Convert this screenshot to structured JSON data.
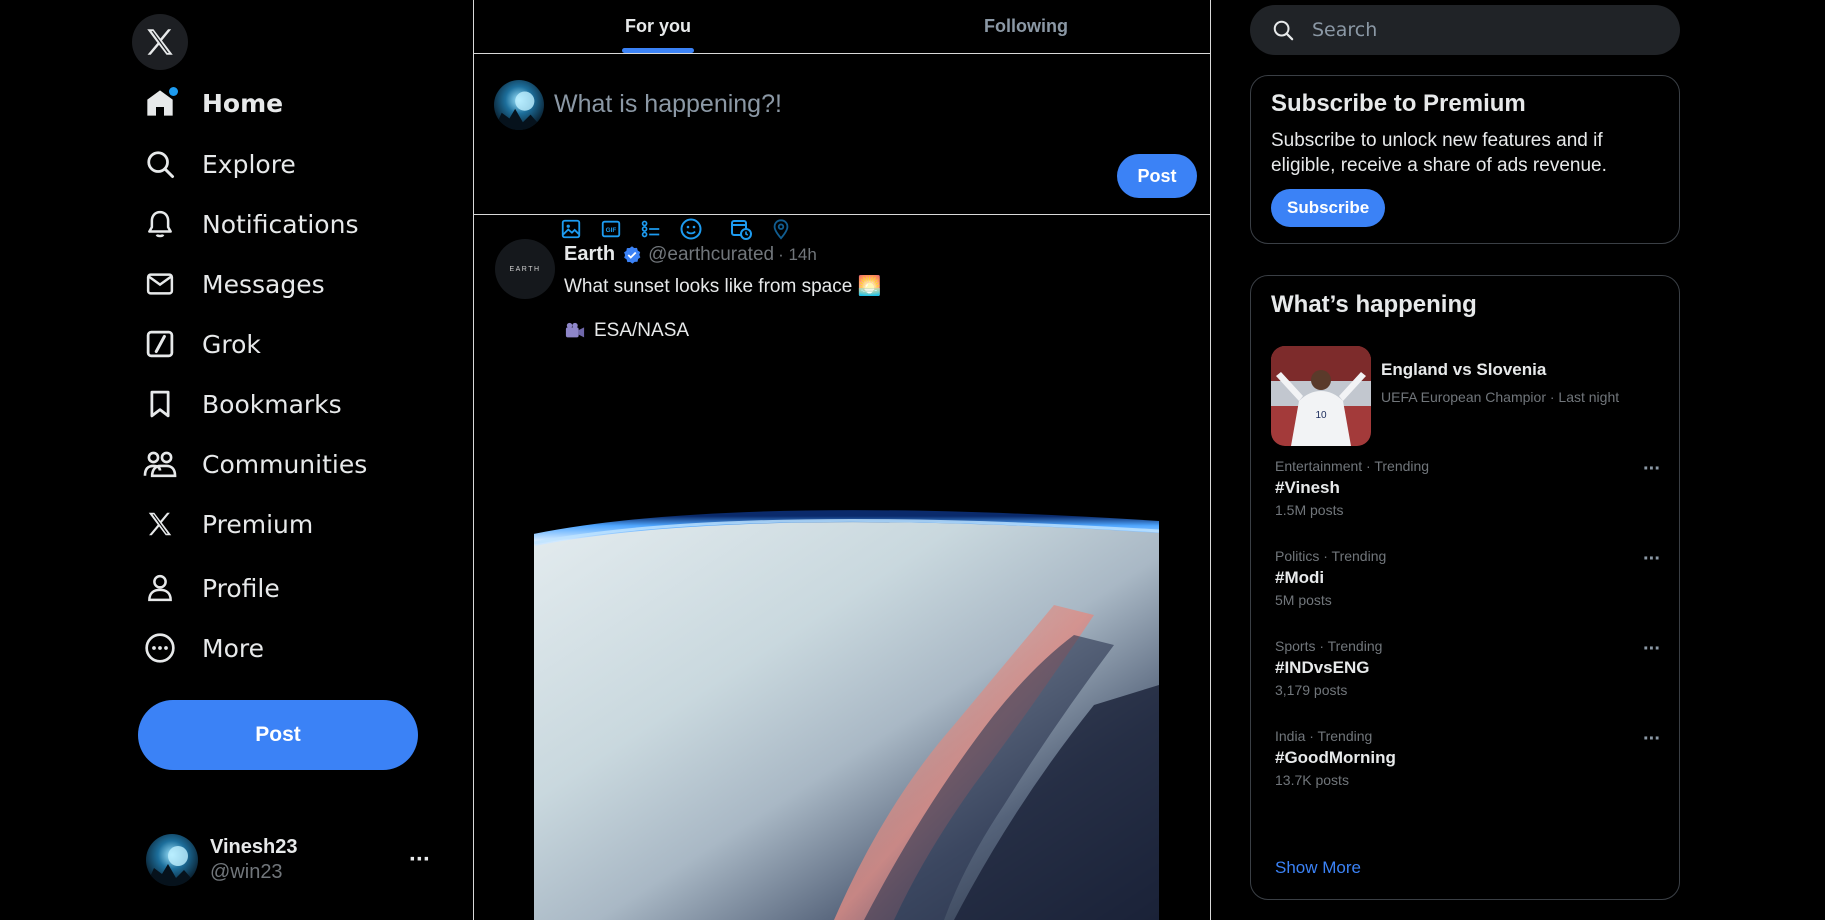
{
  "nav": {
    "items": [
      {
        "label": "Home",
        "icon": "home-icon"
      },
      {
        "label": "Explore",
        "icon": "search-icon"
      },
      {
        "label": "Notifications",
        "icon": "bell-icon"
      },
      {
        "label": "Messages",
        "icon": "envelope-icon"
      },
      {
        "label": "Grok",
        "icon": "grok-icon"
      },
      {
        "label": "Bookmarks",
        "icon": "bookmark-icon"
      },
      {
        "label": "Communities",
        "icon": "people-icon"
      },
      {
        "label": "Premium",
        "icon": "x-logo-icon"
      },
      {
        "label": "Profile",
        "icon": "person-icon"
      },
      {
        "label": "More",
        "icon": "more-circle-icon"
      }
    ],
    "post_label": "Post"
  },
  "account": {
    "display_name": "Vinesh23",
    "handle": "@win23",
    "more": "···"
  },
  "tabs": [
    {
      "label": "For you"
    },
    {
      "label": "Following"
    }
  ],
  "compose": {
    "placeholder": "What is happening?!",
    "tools": [
      "image-icon",
      "gif-icon",
      "poll-icon",
      "emoji-icon",
      "schedule-icon",
      "location-icon"
    ],
    "post_label": "Post"
  },
  "tweet": {
    "name": "Earth",
    "verified": true,
    "handle": "@earthcurated",
    "time": "· 14h",
    "text": "What sunset looks like from space 🌅",
    "credit": "ESA/NASA",
    "avatar_text": "EARTH"
  },
  "search": {
    "placeholder": "Search"
  },
  "premium": {
    "title": "Subscribe to Premium",
    "description": "Subscribe to unlock new features and if eligible, receive a share of ads revenue.",
    "button": "Subscribe"
  },
  "happening": {
    "title": "What’s happening",
    "feature": {
      "title": "England vs Slovenia",
      "meta": "UEFA European Champior · Last night"
    },
    "trends": [
      {
        "meta": "Entertainment · Trending",
        "tag": "#Vinesh",
        "count": "1.5M posts"
      },
      {
        "meta": "Politics · Trending",
        "tag": "#Modi",
        "count": "5M posts"
      },
      {
        "meta": "Sports · Trending",
        "tag": "#INDvsENG",
        "count": "3,179 posts"
      },
      {
        "meta": "India · Trending",
        "tag": "#GoodMorning",
        "count": "13.7K posts"
      }
    ],
    "trend_more": "···",
    "show_more": "Show More"
  },
  "colors": {
    "accent": "#3b82f6",
    "background": "#000000",
    "muted": "#71767b"
  }
}
